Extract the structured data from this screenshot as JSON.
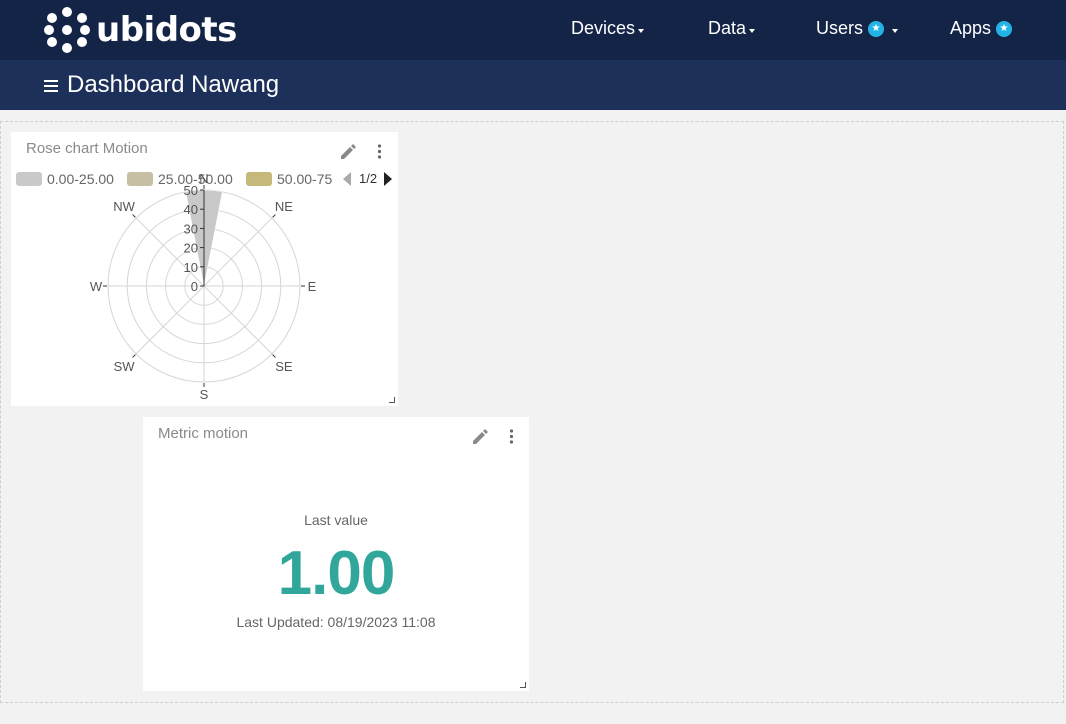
{
  "brand": {
    "name": "ubidots"
  },
  "nav": {
    "devices": "Devices",
    "data": "Data",
    "users": "Users",
    "apps": "Apps",
    "badge_icon": "star-icon"
  },
  "dashboard": {
    "title": "Dashboard Nawang"
  },
  "colors": {
    "topbar": "#132447",
    "subbar": "#1c3059",
    "accent": "#30a79a",
    "badge": "#23b4e6"
  },
  "rose_widget": {
    "title": "Rose chart Motion",
    "pager": "1/2",
    "chart_data": {
      "type": "rose",
      "legend": [
        {
          "label": "0.00-25.00",
          "color": "#c9c9c9"
        },
        {
          "label": "25.00-50.00",
          "color": "#c6bfa3"
        },
        {
          "label": "50.00-75",
          "color": "#c6b87a"
        }
      ],
      "directions": [
        "N",
        "NE",
        "E",
        "SE",
        "S",
        "SW",
        "W",
        "NW"
      ],
      "radial_ticks": [
        "0",
        "10",
        "20",
        "30",
        "40",
        "50"
      ],
      "rlim": [
        0,
        50
      ],
      "series": [
        {
          "direction": "N",
          "value": 50,
          "color": "#c9c9c9"
        }
      ]
    }
  },
  "metric_widget": {
    "title": "Metric motion",
    "label": "Last value",
    "value": "1.00",
    "updated": "Last Updated: 08/19/2023 11:08"
  }
}
